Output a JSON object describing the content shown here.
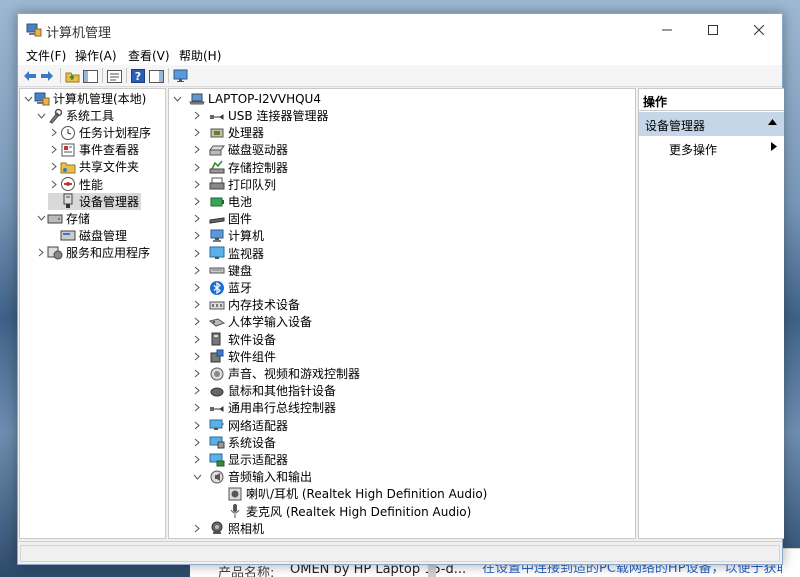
{
  "window": {
    "title": "计算机管理"
  },
  "menu": [
    "文件(F)",
    "操作(A)",
    "查看(V)",
    "帮助(H)"
  ],
  "left_tree": [
    {
      "label": "计算机管理(本地)",
      "icon": "computer-management-icon",
      "arrow": "down",
      "indent": 0
    },
    {
      "label": "系统工具",
      "icon": "system-tools-icon",
      "arrow": "down",
      "indent": 1
    },
    {
      "label": "任务计划程序",
      "icon": "task-scheduler-icon",
      "arrow": "right",
      "indent": 2
    },
    {
      "label": "事件查看器",
      "icon": "event-viewer-icon",
      "arrow": "right",
      "indent": 2
    },
    {
      "label": "共享文件夹",
      "icon": "shared-folder-icon",
      "arrow": "right",
      "indent": 2
    },
    {
      "label": "性能",
      "icon": "performance-icon",
      "arrow": "right",
      "indent": 2
    },
    {
      "label": "设备管理器",
      "icon": "device-manager-icon",
      "arrow": "",
      "indent": 2,
      "selected": true
    },
    {
      "label": "存储",
      "icon": "storage-icon",
      "arrow": "down",
      "indent": 1
    },
    {
      "label": "磁盘管理",
      "icon": "disk-management-icon",
      "arrow": "",
      "indent": 2
    },
    {
      "label": "服务和应用程序",
      "icon": "services-icon",
      "arrow": "right",
      "indent": 1
    }
  ],
  "device_tree": {
    "root": "LAPTOP-I2VVHQU4",
    "categories": [
      {
        "label": "USB 连接器管理器",
        "icon": "usb-icon",
        "arrow": "right"
      },
      {
        "label": "处理器",
        "icon": "processor-icon",
        "arrow": "right"
      },
      {
        "label": "磁盘驱动器",
        "icon": "disk-drive-icon",
        "arrow": "right"
      },
      {
        "label": "存储控制器",
        "icon": "storage-controller-icon",
        "arrow": "right"
      },
      {
        "label": "打印队列",
        "icon": "printer-icon",
        "arrow": "right"
      },
      {
        "label": "电池",
        "icon": "battery-icon",
        "arrow": "right"
      },
      {
        "label": "固件",
        "icon": "firmware-icon",
        "arrow": "right"
      },
      {
        "label": "计算机",
        "icon": "computer-icon",
        "arrow": "right"
      },
      {
        "label": "监视器",
        "icon": "monitor-icon",
        "arrow": "right"
      },
      {
        "label": "键盘",
        "icon": "keyboard-icon",
        "arrow": "right"
      },
      {
        "label": "蓝牙",
        "icon": "bluetooth-icon",
        "arrow": "right"
      },
      {
        "label": "内存技术设备",
        "icon": "memory-icon",
        "arrow": "right"
      },
      {
        "label": "人体学输入设备",
        "icon": "hid-icon",
        "arrow": "right"
      },
      {
        "label": "软件设备",
        "icon": "software-device-icon",
        "arrow": "right"
      },
      {
        "label": "软件组件",
        "icon": "software-component-icon",
        "arrow": "right"
      },
      {
        "label": "声音、视频和游戏控制器",
        "icon": "sound-icon",
        "arrow": "right"
      },
      {
        "label": "鼠标和其他指针设备",
        "icon": "mouse-icon",
        "arrow": "right"
      },
      {
        "label": "通用串行总线控制器",
        "icon": "usb-controller-icon",
        "arrow": "right"
      },
      {
        "label": "网络适配器",
        "icon": "network-adapter-icon",
        "arrow": "right"
      },
      {
        "label": "系统设备",
        "icon": "system-device-icon",
        "arrow": "right"
      },
      {
        "label": "显示适配器",
        "icon": "display-adapter-icon",
        "arrow": "right"
      },
      {
        "label": "音频输入和输出",
        "icon": "audio-io-icon",
        "arrow": "down"
      },
      {
        "label": "喇叭/耳机 (Realtek High Definition Audio)",
        "icon": "speaker-icon",
        "arrow": "",
        "child": true
      },
      {
        "label": "麦克风 (Realtek High Definition Audio)",
        "icon": "microphone-icon",
        "arrow": "",
        "child": true
      },
      {
        "label": "照相机",
        "icon": "camera-icon",
        "arrow": "right"
      }
    ]
  },
  "actions": {
    "header": "操作",
    "group": "设备管理器",
    "item": "更多操作"
  },
  "background_window": {
    "label": "产品名称:",
    "value": "OMEN by HP Laptop 15-d...",
    "link": "在设置中连接到适的PC载网络的HP设备，以便于获取更多..."
  }
}
